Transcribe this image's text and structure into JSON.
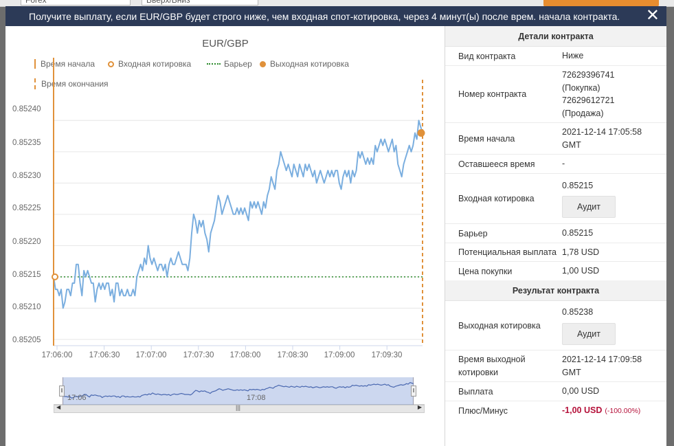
{
  "background": {
    "field1": "Forex",
    "field2": "Вверх/Вниз"
  },
  "dialog": {
    "title": "Получите выплату, если EUR/GBP будет строго ниже, чем входная спот-котировка, через 4 минут(ы) после врем. начала контракта.",
    "close_icon": "close-icon"
  },
  "chart_data": {
    "type": "line",
    "title": "EUR/GBP",
    "legend": [
      "Время начала",
      "Входная котировка",
      "Барьер",
      "Выходная котировка",
      "Время окончания"
    ],
    "y_ticks": [
      "0.85240",
      "0.85235",
      "0.85230",
      "0.85225",
      "0.85220",
      "0.85215",
      "0.85210",
      "0.85205"
    ],
    "x_ticks": [
      "17:06:00",
      "17:06:30",
      "17:07:00",
      "17:07:30",
      "17:08:00",
      "17:08:30",
      "17:09:00",
      "17:09:30"
    ],
    "ylim": [
      0.85204,
      0.85243
    ],
    "x_start": "17:05:58",
    "x_end": "17:09:58",
    "entry_spot": 0.85215,
    "barrier": 0.85215,
    "exit_spot": 0.85238,
    "series": [
      {
        "values": [
          0.85215,
          0.85213,
          0.85213,
          0.85212,
          0.85213,
          0.8521,
          0.85211,
          0.85213,
          0.85213,
          0.85212,
          0.85214,
          0.85214,
          0.85217,
          0.85217,
          0.85214,
          0.85212,
          0.85216,
          0.85215,
          0.85216,
          0.85215,
          0.85214,
          0.85214,
          0.85211,
          0.85213,
          0.85214,
          0.85213,
          0.85214,
          0.85213,
          0.85214,
          0.85214,
          0.85212,
          0.85213,
          0.85211,
          0.85214,
          0.85214,
          0.85212,
          0.85213,
          0.85212,
          0.85212,
          0.85213,
          0.85212,
          0.85212,
          0.85213,
          0.85212,
          0.85215,
          0.85216,
          0.85217,
          0.85216,
          0.85218,
          0.85217,
          0.8522,
          0.85218,
          0.85217,
          0.85218,
          0.85217,
          0.85216,
          0.85217,
          0.85217,
          0.85216,
          0.85217,
          0.85215,
          0.85217,
          0.85218,
          0.85217,
          0.85217,
          0.85218,
          0.85219,
          0.85218,
          0.85217,
          0.85217,
          0.85217,
          0.85216,
          0.85218,
          0.85222,
          0.85225,
          0.85224,
          0.85222,
          0.85224,
          0.85223,
          0.85224,
          0.85222,
          0.85221,
          0.85219,
          0.85222,
          0.85223,
          0.85224,
          0.85226,
          0.85228,
          0.85227,
          0.85225,
          0.85226,
          0.85227,
          0.85228,
          0.85227,
          0.85226,
          0.85225,
          0.85225,
          0.85226,
          0.85225,
          0.85226,
          0.85225,
          0.85226,
          0.85225,
          0.85224,
          0.85227,
          0.85226,
          0.85227,
          0.85226,
          0.85227,
          0.85226,
          0.85225,
          0.85227,
          0.85226,
          0.85228,
          0.85229,
          0.85231,
          0.8523,
          0.85229,
          0.85232,
          0.85233,
          0.85235,
          0.85234,
          0.85233,
          0.85232,
          0.85233,
          0.85232,
          0.85231,
          0.85233,
          0.85232,
          0.85231,
          0.85233,
          0.85232,
          0.85231,
          0.85233,
          0.85232,
          0.85233,
          0.85232,
          0.85231,
          0.85232,
          0.8523,
          0.85231,
          0.85232,
          0.85231,
          0.8523,
          0.85231,
          0.85232,
          0.85231,
          0.85232,
          0.85231,
          0.85232,
          0.85232,
          0.8523,
          0.85229,
          0.85231,
          0.85232,
          0.85231,
          0.85232,
          0.8523,
          0.85232,
          0.85231,
          0.85232,
          0.85235,
          0.85234,
          0.85235,
          0.85234,
          0.85233,
          0.85234,
          0.85233,
          0.85234,
          0.85233,
          0.85236,
          0.85235,
          0.85236,
          0.85237,
          0.85236,
          0.85237,
          0.85236,
          0.85235,
          0.85236,
          0.85237,
          0.85235,
          0.85236,
          0.85233,
          0.85232,
          0.85231,
          0.85233,
          0.85234,
          0.85235,
          0.85236,
          0.85235,
          0.85236,
          0.85238,
          0.85237,
          0.8524,
          0.85239,
          0.85238
        ]
      }
    ]
  },
  "navigator": {
    "left_label": "17:06",
    "mid_label": "17:08"
  },
  "details": {
    "header": "Детали контракта",
    "contract_type_label": "Вид контракта",
    "contract_type": "Ниже",
    "contract_id_label": "Номер контракта",
    "contract_id_lines": [
      "72629396741",
      "(Покупка)",
      "72629612721",
      "(Продажа)"
    ],
    "start_time_label": "Время начала",
    "start_time": "2021-12-14 17:05:58 GMT",
    "remaining_label": "Оставшееся время",
    "remaining": "-",
    "entry_label": "Входная котировка",
    "entry": "0.85215",
    "audit_label": "Аудит",
    "barrier_label": "Барьер",
    "barrier": "0.85215",
    "payout_label": "Потенциальная выплата",
    "payout": "1,78 USD",
    "price_label": "Цена покупки",
    "price": "1,00 USD"
  },
  "result": {
    "header": "Результат контракта",
    "exit_label": "Выходная котировка",
    "exit": "0.85238",
    "audit_label": "Аудит",
    "exit_time_label": "Время выходной котировки",
    "exit_time": "2021-12-14 17:09:58 GMT",
    "payout_label": "Выплата",
    "payout": "0,00 USD",
    "pl_label": "Плюс/Минус",
    "pl": "-1,00 USD",
    "pl_pct": "(-100.00%)"
  },
  "colors": {
    "header": "#2c3a57",
    "line": "#7aaedf",
    "orange": "#e0913a",
    "barrier": "#2a8a2a",
    "negative": "#b5113a"
  }
}
